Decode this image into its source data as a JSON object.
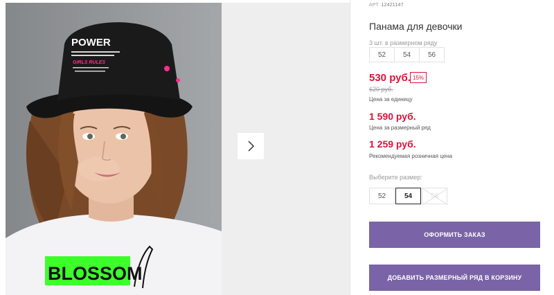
{
  "gallery": {
    "hat_text": {
      "line1": "POWER",
      "line2": "GIRLS RULES"
    },
    "shirt_text": "BLOSSOM"
  },
  "product": {
    "art_label": "АРТ.",
    "art_code": "12421147",
    "title": "Панама для девочки",
    "row_label": "3 шт. в размерном ряду",
    "row_sizes": [
      "52",
      "54",
      "56"
    ],
    "price": "530 руб.",
    "discount": "15%",
    "old_price": "620 руб.",
    "price_unit_caption": "Цена за единицу",
    "row_price": "1 590 руб.",
    "row_price_caption": "Цена за размерный ряд",
    "rrp": "1 259 руб.",
    "rrp_caption": "Рекомендуемая розничная цена",
    "size_select_label": "Выберите размер:",
    "size_options": [
      {
        "label": "52",
        "state": "available"
      },
      {
        "label": "54",
        "state": "selected"
      },
      {
        "label": "56",
        "state": "disabled"
      }
    ],
    "order_button": "ОФОРМИТЬ ЗАКАЗ",
    "add_row_button": "ДОБАВИТЬ РАЗМЕРНЫЙ РЯД В КОРЗИНУ"
  },
  "colors": {
    "accent": "#7a63a6",
    "price_red": "#d9123a",
    "neon_green": "#3cff2c"
  }
}
